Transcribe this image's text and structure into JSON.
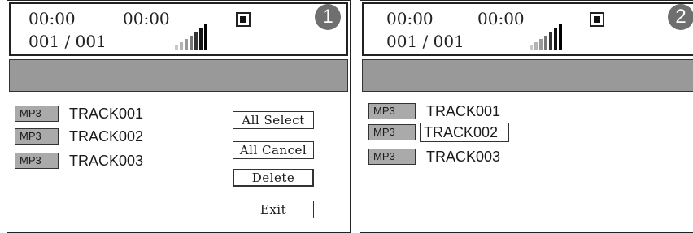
{
  "panels": [
    {
      "badge": "1",
      "time_elapsed": "00:00",
      "time_total": "00:00",
      "counter": "001 / 001",
      "tracks": [
        {
          "tag": "MP3",
          "name": "TRACK001",
          "selected": false
        },
        {
          "tag": "MP3",
          "name": "TRACK002",
          "selected": false
        },
        {
          "tag": "MP3",
          "name": "TRACK003",
          "selected": false
        }
      ],
      "buttons": [
        "All Select",
        "All Cancel",
        "Delete",
        "Exit"
      ],
      "focused_button": "Delete"
    },
    {
      "badge": "2",
      "time_elapsed": "00:00",
      "time_total": "00:00",
      "counter": "001 / 001",
      "tracks": [
        {
          "tag": "MP3",
          "name": "TRACK001",
          "selected": false
        },
        {
          "tag": "MP3",
          "name": "TRACK002",
          "selected": true
        },
        {
          "tag": "MP3",
          "name": "TRACK003",
          "selected": false
        }
      ]
    }
  ],
  "icons": {
    "signal": "signal-strength-icon",
    "stop": "stop-icon"
  },
  "colors": {
    "header_bar": "#999999",
    "tag_bg": "#aaaaaa",
    "badge_bg": "#6f6f6f",
    "border": "#222222"
  }
}
